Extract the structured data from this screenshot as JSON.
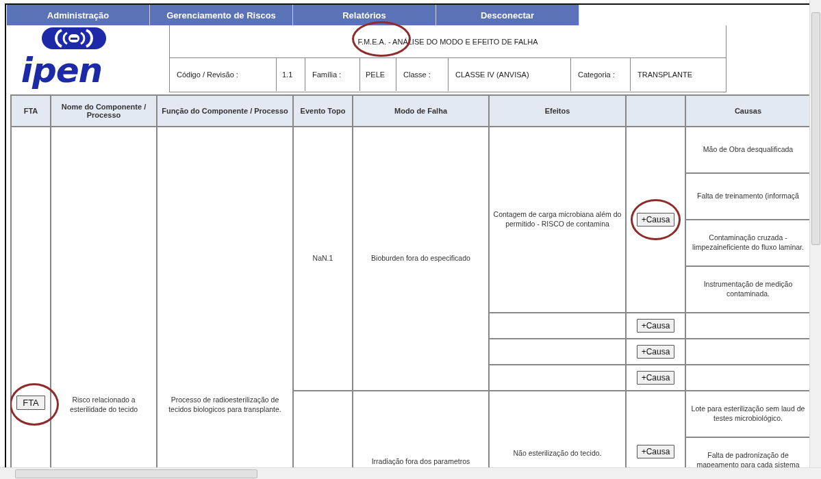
{
  "nav": [
    {
      "label": "Administração"
    },
    {
      "label": "Gerenciamento de Riscos"
    },
    {
      "label": "Relatórios"
    },
    {
      "label": "Desconectar"
    }
  ],
  "logo": {
    "text": "ipen"
  },
  "header": {
    "title": "F.M.E.A. - ANÁLISE DO MODO E EFEITO DE FALHA",
    "title_circled": true,
    "fields": [
      {
        "label": "Código / Revisão :",
        "value": "1.1"
      },
      {
        "label": "Família :",
        "value": "PELE"
      },
      {
        "label": "Classe :",
        "value": "CLASSE IV (ANVISA)"
      },
      {
        "label": "Categoria :",
        "value": "TRANSPLANTE"
      }
    ]
  },
  "table": {
    "columns": [
      {
        "kind": "text",
        "label": "FTA"
      },
      {
        "kind": "text",
        "label": "Nome do Componente / Processo"
      },
      {
        "kind": "text",
        "label": "Função do Componente / Processo"
      },
      {
        "kind": "text",
        "label": "Evento Topo"
      },
      {
        "kind": "text",
        "label": "Modo de Falha"
      },
      {
        "kind": "text",
        "label": "Efeitos"
      },
      {
        "kind": "blank"
      },
      {
        "kind": "text",
        "label": "Causas"
      }
    ],
    "rows": [
      {
        "fta_button": {
          "label": "FTA",
          "circled": true
        },
        "name": "Risco relacionado a esterilidade do tecido",
        "function": "Processo de radioesterilização de tecidos biologicos para transplante.",
        "modes": [
          {
            "event": "NaN.1",
            "mode": "Bioburden fora do especificado",
            "effects": [
              {
                "text": "Contagem de carga microbiana além do permitido - RISCO de contamina",
                "button": {
                  "label": "+Causa",
                  "circled": true
                },
                "causes": [
                  "Mão de Obra desqualificada",
                  "Falta de treinamento (informaçã",
                  "Contaminação cruzada - limpezaineficiente do fluxo laminar.",
                  "Instrumentação de medição contaminada."
                ]
              },
              {
                "button": {
                  "label": "+Causa",
                  "circled": false
                }
              },
              {
                "button": {
                  "label": "+Causa",
                  "circled": false
                }
              },
              {
                "button": {
                  "label": "+Causa",
                  "circled": false
                }
              }
            ]
          },
          {
            "mode": "Irradiação fora dos parametros",
            "effects": [
              {
                "text": "Não esterilização do tecido.",
                "button": {
                  "label": "+Causa",
                  "circled": false
                },
                "causes": [
                  "Lote para esterilização sem laud de testes microbiológico.",
                  "Falta de padronização de mapeamento para cada sistema"
                ]
              }
            ]
          }
        ]
      }
    ]
  }
}
